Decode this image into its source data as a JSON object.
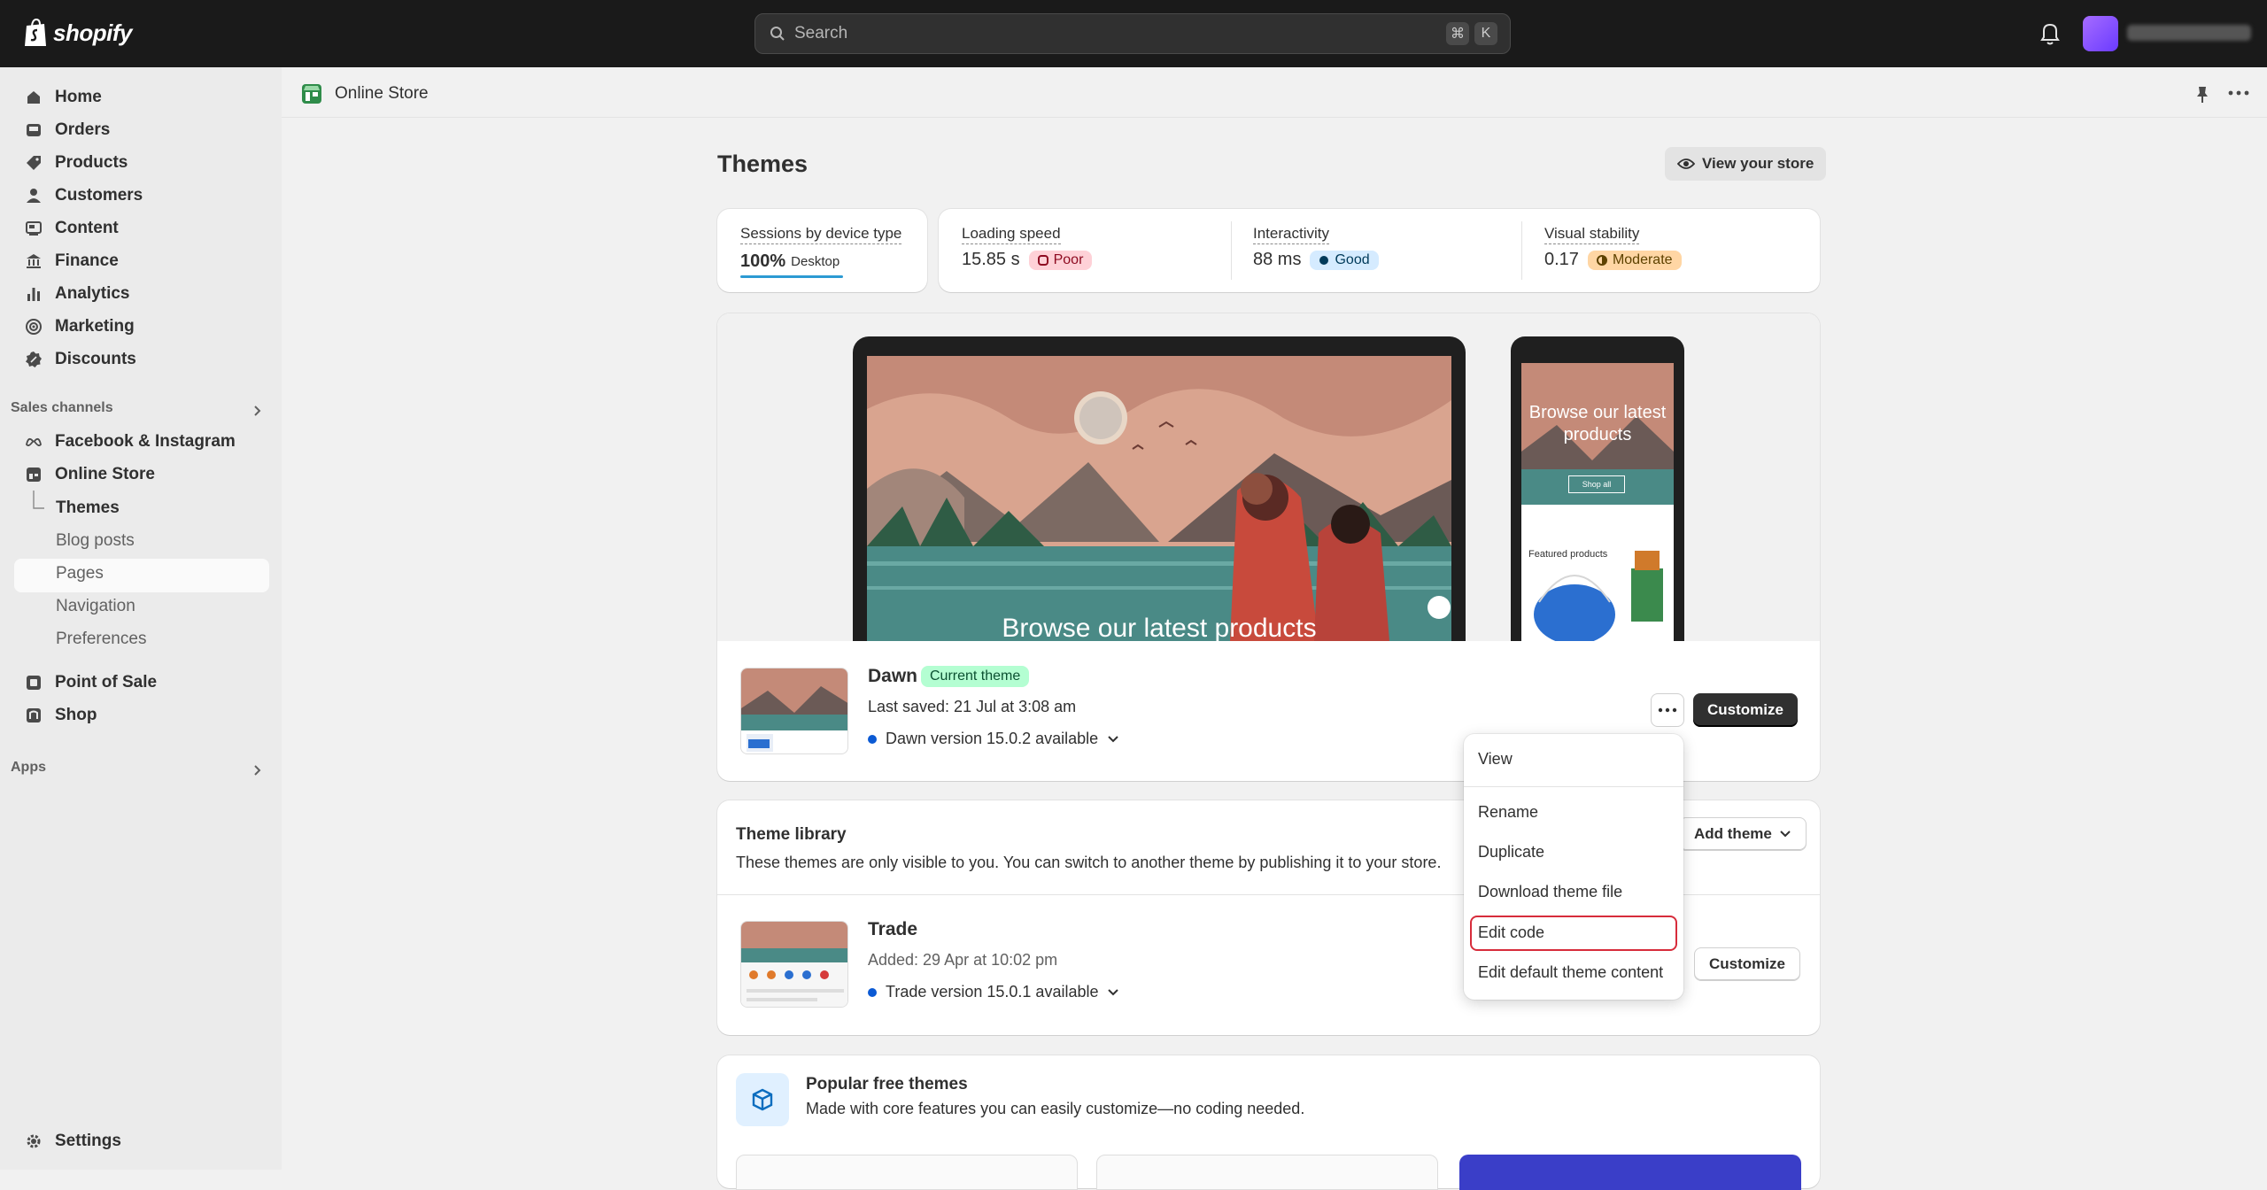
{
  "topbar": {
    "brand": "shopify",
    "search_placeholder": "Search",
    "shortcut_cmd": "⌘",
    "shortcut_key": "K"
  },
  "sidebar": {
    "items": [
      {
        "label": "Home",
        "icon": "home-icon"
      },
      {
        "label": "Orders",
        "icon": "inbox-icon"
      },
      {
        "label": "Products",
        "icon": "tag-icon"
      },
      {
        "label": "Customers",
        "icon": "person-icon"
      },
      {
        "label": "Content",
        "icon": "content-icon"
      },
      {
        "label": "Finance",
        "icon": "bank-icon"
      },
      {
        "label": "Analytics",
        "icon": "bar-chart-icon"
      },
      {
        "label": "Marketing",
        "icon": "target-icon"
      },
      {
        "label": "Discounts",
        "icon": "discount-icon"
      }
    ],
    "sales_channels_label": "Sales channels",
    "channels": [
      {
        "label": "Facebook & Instagram",
        "icon": "meta-icon"
      },
      {
        "label": "Online Store",
        "icon": "store-icon"
      }
    ],
    "online_store_subitems": [
      "Themes",
      "Blog posts",
      "Pages",
      "Navigation",
      "Preferences"
    ],
    "other_channels": [
      {
        "label": "Point of Sale",
        "icon": "pos-icon"
      },
      {
        "label": "Shop",
        "icon": "shop-icon"
      }
    ],
    "apps_label": "Apps",
    "settings_label": "Settings"
  },
  "breadcrumb": {
    "label": "Online Store"
  },
  "page": {
    "title": "Themes",
    "view_store_label": "View your store"
  },
  "metrics": {
    "sessions_label": "Sessions by device type",
    "sessions_value": "100%",
    "sessions_device": "Desktop",
    "loading_label": "Loading speed",
    "loading_value": "15.85 s",
    "loading_badge": "Poor",
    "interactivity_label": "Interactivity",
    "interactivity_value": "88 ms",
    "interactivity_badge": "Good",
    "stability_label": "Visual stability",
    "stability_value": "0.17",
    "stability_badge": "Moderate"
  },
  "preview": {
    "desktop_headline": "Browse our latest products",
    "mobile_headline": "Browse our latest products",
    "mobile_button": "Shop all",
    "mobile_featured": "Featured products"
  },
  "current_theme": {
    "name": "Dawn",
    "badge": "Current theme",
    "last_saved": "Last saved: 21 Jul at 3:08 am",
    "version": "Dawn version 15.0.2 available",
    "customize_label": "Customize"
  },
  "menu": {
    "items": [
      "View",
      "Rename",
      "Duplicate",
      "Download theme file",
      "Edit code",
      "Edit default theme content"
    ]
  },
  "library": {
    "title": "Theme library",
    "subtitle": "These themes are only visible to you. You can switch to another theme by publishing it to your store.",
    "add_theme_label": "Add theme",
    "themes": [
      {
        "name": "Trade",
        "added": "Added: 29 Apr at 10:02 pm",
        "version": "Trade version 15.0.1 available",
        "customize_label": "Customize"
      }
    ]
  },
  "popular": {
    "title": "Popular free themes",
    "subtitle": "Made with core features you can easily customize—no coding needed."
  },
  "colors": {
    "topbar": "#1a1a1a",
    "accent_focus": "#d72c3b",
    "badge_current": "#b4fed2"
  }
}
